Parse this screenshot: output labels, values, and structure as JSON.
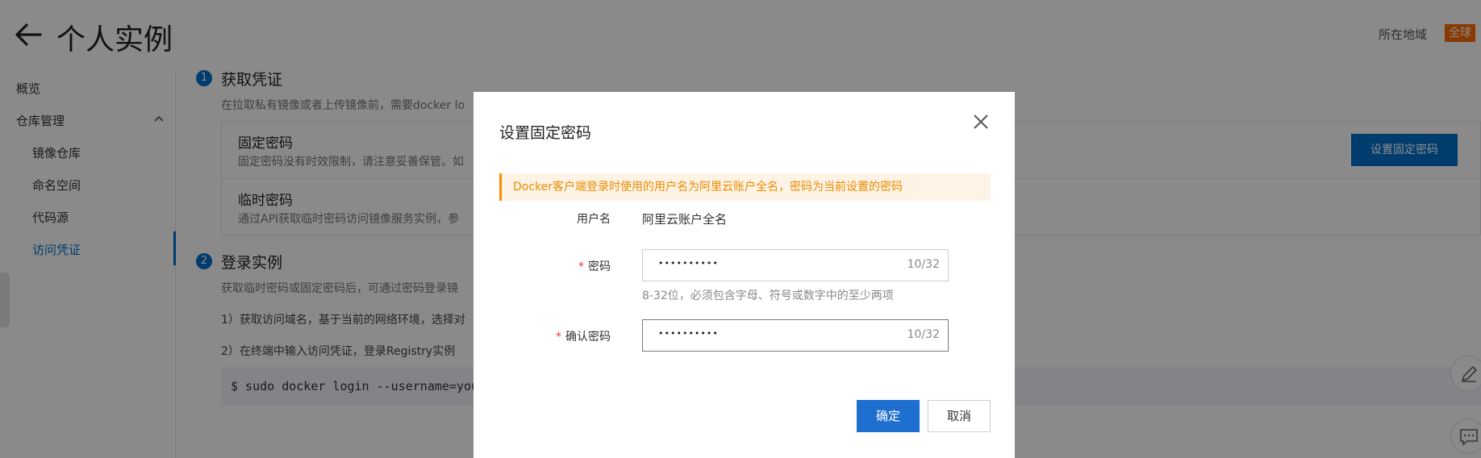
{
  "header": {
    "title": "个人实例",
    "region_label": "所在地域",
    "region_value": "全球"
  },
  "sidebar": {
    "items": [
      {
        "label": "概览"
      },
      {
        "label": "仓库管理"
      },
      {
        "label": "镜像仓库"
      },
      {
        "label": "命名空间"
      },
      {
        "label": "代码源"
      },
      {
        "label": "访问凭证"
      }
    ]
  },
  "main": {
    "step1": {
      "number": "1",
      "title": "获取凭证",
      "desc": "在拉取私有镜像或者上传镜像前，需要docker lo",
      "fixed_title": "固定密码",
      "fixed_desc": "固定密码没有时效限制，请注意妥善保管。如",
      "set_fixed_button": "设置固定密码",
      "temp_title": "临时密码",
      "temp_desc": "通过API获取临时密码访问镜像服务实例，参"
    },
    "step2": {
      "number": "2",
      "title": "登录实例",
      "desc": "获取临时密码或固定密码后，可通过密码登录镜",
      "line1": "1）获取访问域名，基于当前的网络环境，选择对",
      "line2": "2）在终端中输入访问凭证，登录Registry实例",
      "code": "$ sudo docker login --username=you"
    }
  },
  "dialog": {
    "title": "设置固定密码",
    "tip": "Docker客户端登录时使用的用户名为阿里云账户全名，密码为当前设置的密码",
    "username_label": "用户名",
    "username_value": "阿里云账户全名",
    "required_mark": "*",
    "password_label": "密码",
    "password_mask": "••••••••••",
    "password_counter": "10/32",
    "password_hint": "8-32位，必须包含字母、符号或数字中的至少两项",
    "confirm_label": "确认密码",
    "confirm_mask": "••••••••••",
    "confirm_counter": "10/32",
    "ok_button": "确定",
    "cancel_button": "取消"
  },
  "colors": {
    "primary": "#0070cc",
    "button_primary": "#1f6fd1",
    "warning_text": "#e88b00",
    "warning_bg": "#fff3e6",
    "region_badge": "#ff6a00"
  }
}
